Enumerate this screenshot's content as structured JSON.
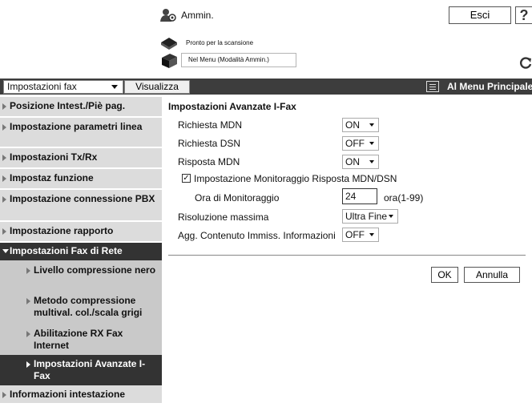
{
  "header": {
    "user_name": "Ammin.",
    "logout_label": "Esci",
    "help_label": "?",
    "status_scan": "Pronto per la scansione",
    "status_menu": "Nel Menu (Modalità Ammin.)"
  },
  "toolbar": {
    "category_select": "Impostazioni fax",
    "view_button": "Visualizza",
    "main_menu_label": "Al Menu Principale"
  },
  "sidebar": {
    "items": [
      {
        "label": "Posizione Intest./Piè pag."
      },
      {
        "label": "Impostazione parametri linea"
      },
      {
        "label": "Impostazioni Tx/Rx"
      },
      {
        "label": "Impostaz funzione"
      },
      {
        "label": "Impostazione connessione PBX"
      },
      {
        "label": "Impostazione rapporto"
      },
      {
        "label": "Impostazioni Fax di Rete"
      },
      {
        "label": "Livello compressione nero"
      },
      {
        "label": "Metodo compressione multival. col./scala grigi"
      },
      {
        "label": "Abilitazione RX Fax Internet"
      },
      {
        "label": "Impostazioni Avanzate I-Fax"
      },
      {
        "label": "Informazioni intestazione"
      }
    ]
  },
  "form": {
    "title": "Impostazioni Avanzate I-Fax",
    "mdn_request_label": "Richiesta MDN",
    "mdn_request_value": "ON",
    "dsn_request_label": "Richiesta DSN",
    "dsn_request_value": "OFF",
    "mdn_response_label": "Risposta MDN",
    "mdn_response_value": "ON",
    "monitor_checkbox_label": "Impostazione Monitoraggio Risposta MDN/DSN",
    "monitor_checked": "✓",
    "monitor_time_label": "Ora di Monitoraggio",
    "monitor_time_value": "24",
    "monitor_time_unit": "ora(1-99)",
    "max_resolution_label": "Risoluzione massima",
    "max_resolution_value": "Ultra Fine",
    "update_content_label": "Agg. Contenuto Immiss. Informazioni",
    "update_content_value": "OFF",
    "ok_label": "OK",
    "cancel_label": "Annulla"
  },
  "colors": {
    "bar": "#3d3d3d",
    "sidebar_item": "#dcdcdc",
    "sidebar_active": "#333333"
  }
}
